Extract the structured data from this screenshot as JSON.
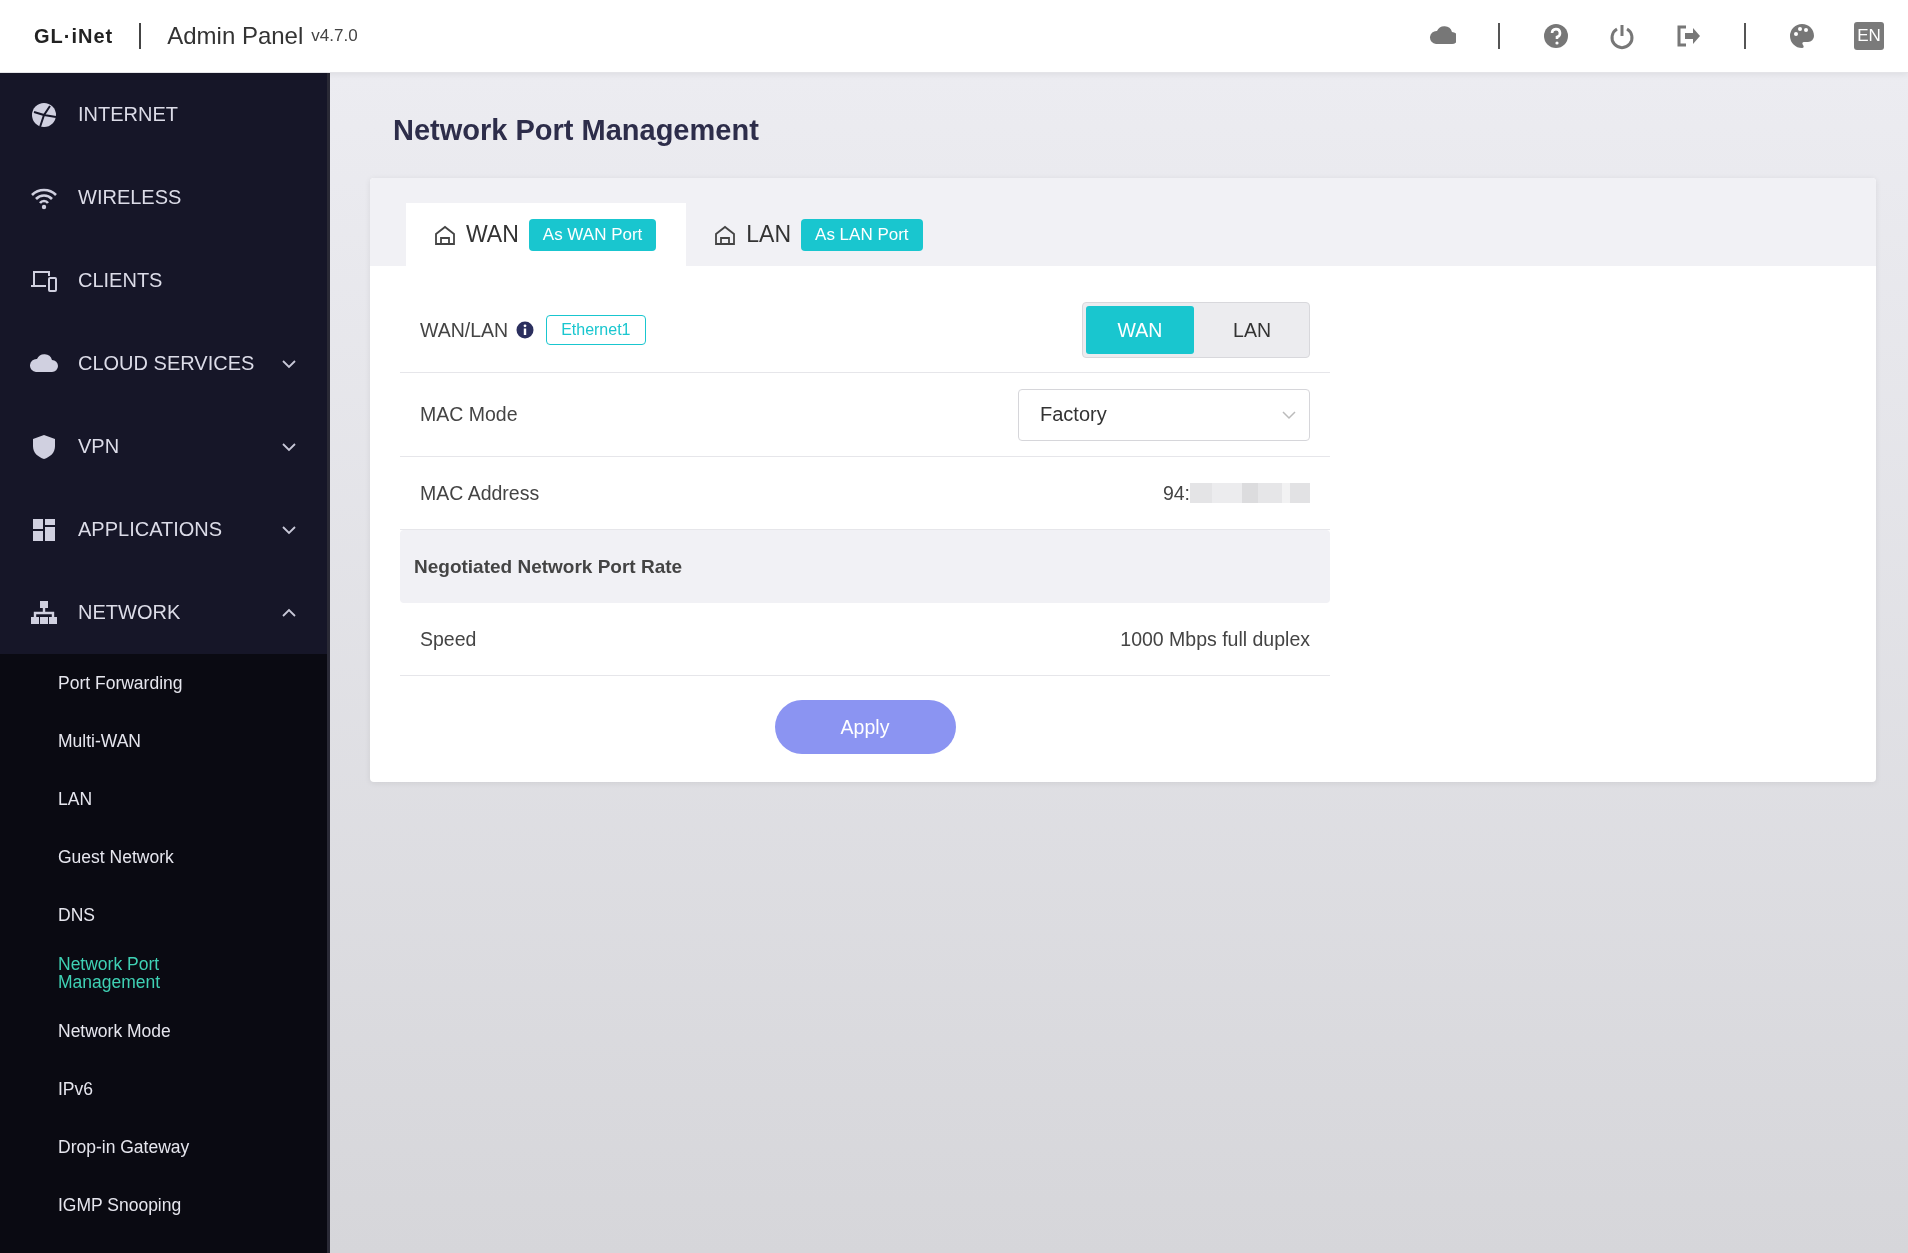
{
  "header": {
    "logo": "GL·iNet",
    "title": "Admin Panel",
    "version": "v4.7.0",
    "language": "EN"
  },
  "sidebar": {
    "items": [
      {
        "label": "INTERNET",
        "kind": "link"
      },
      {
        "label": "WIRELESS",
        "kind": "link"
      },
      {
        "label": "CLIENTS",
        "kind": "link"
      },
      {
        "label": "CLOUD SERVICES",
        "kind": "group",
        "expanded": false
      },
      {
        "label": "VPN",
        "kind": "group",
        "expanded": false
      },
      {
        "label": "APPLICATIONS",
        "kind": "group",
        "expanded": false
      },
      {
        "label": "NETWORK",
        "kind": "group",
        "expanded": true,
        "children": [
          {
            "label": "Port Forwarding",
            "selected": false
          },
          {
            "label": "Multi-WAN",
            "selected": false
          },
          {
            "label": "LAN",
            "selected": false
          },
          {
            "label": "Guest Network",
            "selected": false
          },
          {
            "label": "DNS",
            "selected": false
          },
          {
            "label": "Network Port Management",
            "selected": true
          },
          {
            "label": "Network Mode",
            "selected": false
          },
          {
            "label": "IPv6",
            "selected": false
          },
          {
            "label": "Drop-in Gateway",
            "selected": false
          },
          {
            "label": "IGMP Snooping",
            "selected": false
          }
        ]
      }
    ]
  },
  "main": {
    "title": "Network Port Management",
    "tabs": [
      {
        "label": "WAN",
        "badge": "As WAN Port",
        "selected": true
      },
      {
        "label": "LAN",
        "badge": "As LAN Port",
        "selected": false
      }
    ],
    "rows": [
      {
        "kind": "toggle",
        "label": "WAN/LAN",
        "tag": "Ethernet1",
        "options": [
          {
            "label": "WAN",
            "selected": true
          },
          {
            "label": "LAN",
            "selected": false
          }
        ]
      },
      {
        "kind": "select",
        "label": "MAC Mode",
        "value": "Factory"
      },
      {
        "kind": "text",
        "label": "MAC Address",
        "value": "94:",
        "redacted": true
      },
      {
        "kind": "section",
        "label": "Negotiated Network Port Rate"
      },
      {
        "kind": "text",
        "label": "Speed",
        "value": "1000 Mbps full duplex"
      }
    ],
    "apply": "Apply"
  }
}
